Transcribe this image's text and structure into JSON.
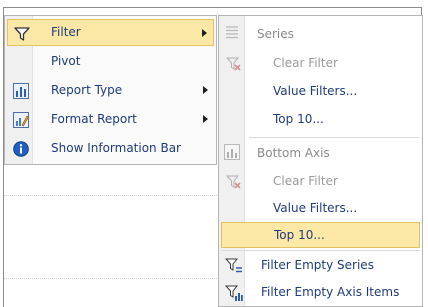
{
  "context_menu": {
    "items": [
      {
        "label": "Filter",
        "icon": "filter-funnel-icon",
        "has_submenu": true,
        "highlighted": true
      },
      {
        "label": "Pivot",
        "icon": "",
        "has_submenu": false
      },
      {
        "label": "Report Type",
        "icon": "bar-chart-icon",
        "has_submenu": true
      },
      {
        "label": "Format Report",
        "icon": "format-report-icon",
        "has_submenu": true
      },
      {
        "label": "Show Information Bar",
        "icon": "info-icon",
        "has_submenu": false
      }
    ]
  },
  "filter_submenu": {
    "series_header": "Series",
    "series_items": [
      {
        "label": "Clear Filter",
        "disabled": true,
        "icon": "clear-filter-icon"
      },
      {
        "label": "Value Filters...",
        "disabled": false
      },
      {
        "label": "Top 10...",
        "disabled": false
      }
    ],
    "axis_header": "Bottom Axis",
    "axis_items": [
      {
        "label": "Clear Filter",
        "disabled": true,
        "icon": "clear-filter-icon"
      },
      {
        "label": "Value Filters...",
        "disabled": false
      },
      {
        "label": "Top 10...",
        "disabled": false,
        "highlighted": true
      }
    ],
    "empty_items": [
      {
        "label": "Filter Empty Series",
        "icon": "filter-empty-series-icon"
      },
      {
        "label": "Filter Empty Axis Items",
        "icon": "filter-empty-axis-icon"
      }
    ]
  }
}
